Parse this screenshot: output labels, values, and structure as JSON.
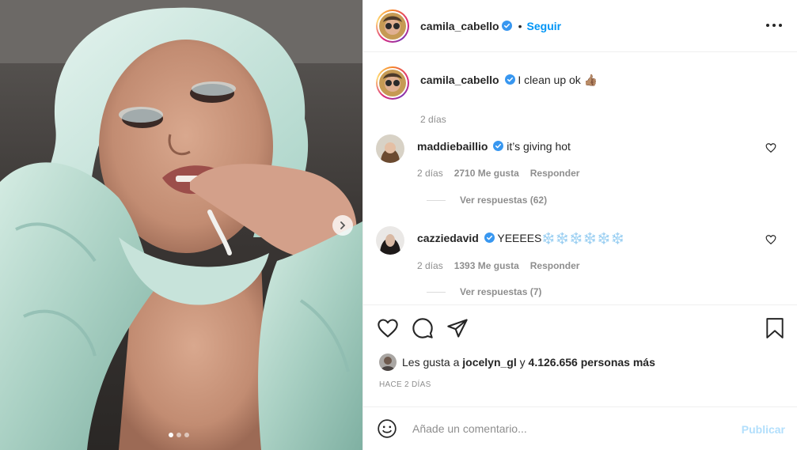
{
  "post": {
    "author": "camila_cabello",
    "follow_label": "Seguir",
    "separator": "•",
    "carousel_count": 3,
    "carousel_active": 0
  },
  "caption": {
    "username": "camila_cabello",
    "text": "I clean up ok 👍🏽",
    "age": "2 días"
  },
  "comments": [
    {
      "username": "maddiebaillio",
      "text": "it’s giving hot",
      "age": "2 días",
      "likes": "2710 Me gusta",
      "reply": "Responder",
      "view_replies": "Ver respuestas (62)"
    },
    {
      "username": "cazziedavid",
      "text": "YEEEES❄️❄️❄️❄️❄️❄️",
      "age": "2 días",
      "likes": "1393 Me gusta",
      "reply": "Responder",
      "view_replies": "Ver respuestas (7)"
    }
  ],
  "likes": {
    "prefix": "Les gusta a",
    "user": "jocelyn_gl",
    "conj": "y",
    "others": "4.126.656 personas más"
  },
  "timestamp": "HACE 2 DÍAS",
  "add_comment": {
    "placeholder": "Añade un comentario...",
    "publish_label": "Publicar"
  },
  "icons": {
    "verified": "verified-badge-icon",
    "like": "heart-icon",
    "comment": "comment-icon",
    "share": "send-icon",
    "save": "bookmark-icon",
    "emoji": "emoji-icon",
    "more": "more-options-icon",
    "next": "chevron-right-icon"
  },
  "colors": {
    "accent": "#0095f6",
    "verified": "#3897f0",
    "muted": "#8e8e8e",
    "publish_disabled": "#b2dffc"
  }
}
